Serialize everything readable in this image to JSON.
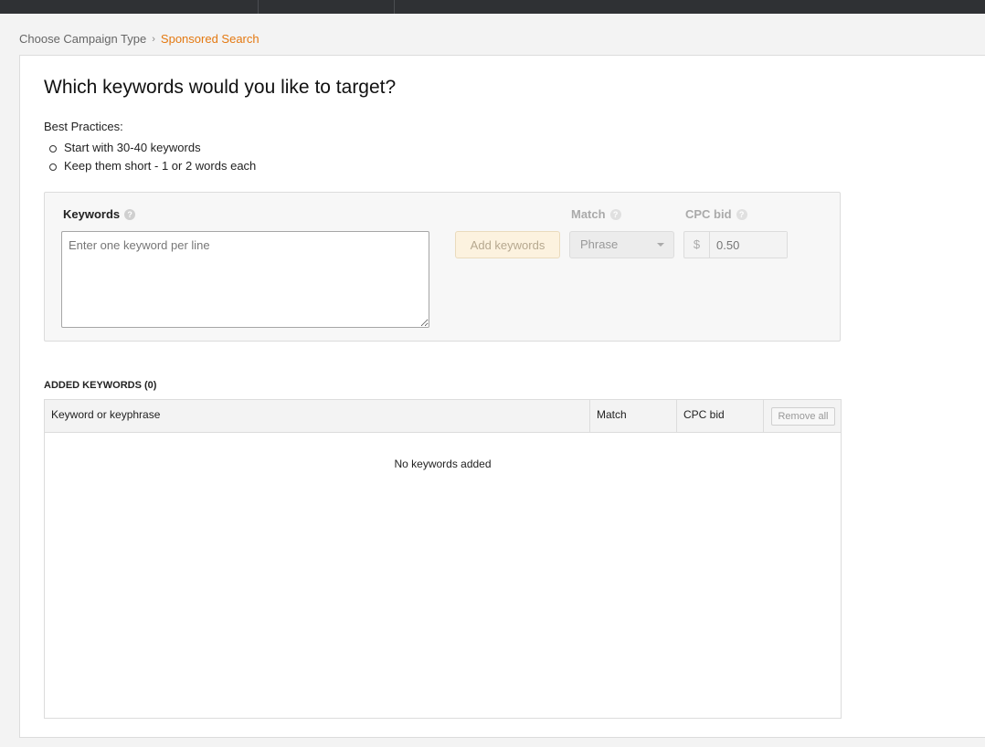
{
  "breadcrumb": {
    "step1": "Choose Campaign Type",
    "current": "Sponsored Search"
  },
  "page": {
    "title": "Which keywords would you like to target?",
    "best_practices_label": "Best Practices:",
    "best_practices": [
      "Start with 30-40 keywords",
      "Keep them short - 1 or 2 words each"
    ]
  },
  "keyword_form": {
    "keywords_label": "Keywords",
    "keywords_placeholder": "Enter one keyword per line",
    "add_button": "Add keywords",
    "match_label": "Match",
    "match_value": "Phrase",
    "cpc_label": "CPC bid",
    "currency": "$",
    "cpc_placeholder": "0.50"
  },
  "added_keywords": {
    "heading": "ADDED KEYWORDS (0)",
    "columns": [
      "Keyword or keyphrase",
      "Match",
      "CPC bid"
    ],
    "remove_all": "Remove all",
    "empty_message": "No keywords added"
  },
  "colors": {
    "accent": "#e47911",
    "topbar": "#2f3134"
  }
}
